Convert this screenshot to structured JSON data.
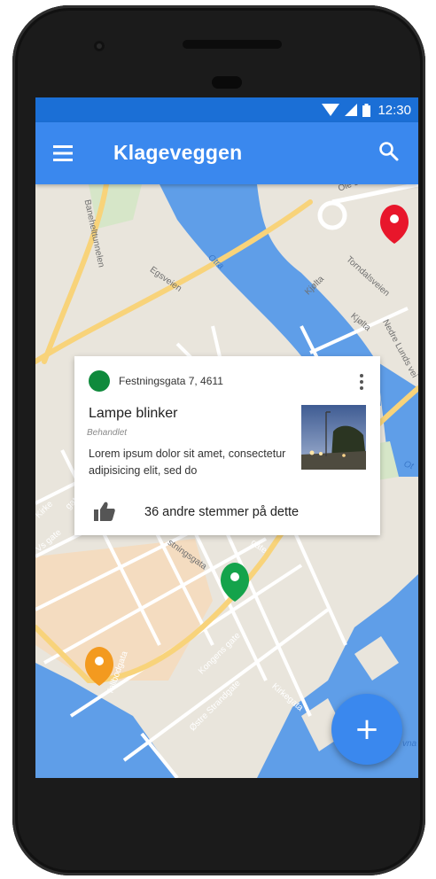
{
  "status_bar": {
    "time": "12:30"
  },
  "app_bar": {
    "title": "Klageveggen",
    "menu_icon": "hamburger-menu-icon",
    "search_icon": "search-icon"
  },
  "map": {
    "labels": {
      "ole_bull": "Ole Bu",
      "banehelt": "Banehelttunnelen",
      "egsveien": "Egsveien",
      "otra": "Otra",
      "kjolta1": "Kjølta",
      "torndals": "Torndalsveien",
      "nedre": "Nedre Lunds vei",
      "kjolta2": "Kjølta",
      "vsgate": "Vs gate",
      "kirke": "Kirke",
      "gate1": "gate",
      "festnings": "stningsgata",
      "gate2": "gate",
      "tollbod": "Tollbodgata",
      "kongens": "Kongens gate",
      "kirkegata": "Kirkegata",
      "ostre": "Østre Strandgate",
      "otra2": "Ot",
      "vna": "vna"
    },
    "pins": [
      {
        "name": "pin-red",
        "color": "#e8162b"
      },
      {
        "name": "pin-green",
        "color": "#14a34b"
      },
      {
        "name": "pin-orange",
        "color": "#f39a1f"
      }
    ]
  },
  "card": {
    "address": "Festningsgata 7, 4611",
    "title": "Lampe blinker",
    "status": "Behandlet",
    "status_color": "#0f8a3c",
    "description": "Lorem ipsum dolor sit amet, consectetur adipisicing elit, sed do",
    "votes_text": "36 andre stemmer på dette",
    "photo_icon": "street-lamp-photo"
  },
  "fab": {
    "label": "+"
  },
  "colors": {
    "primary": "#3a88ee",
    "primary_dark": "#1b6fd6"
  }
}
